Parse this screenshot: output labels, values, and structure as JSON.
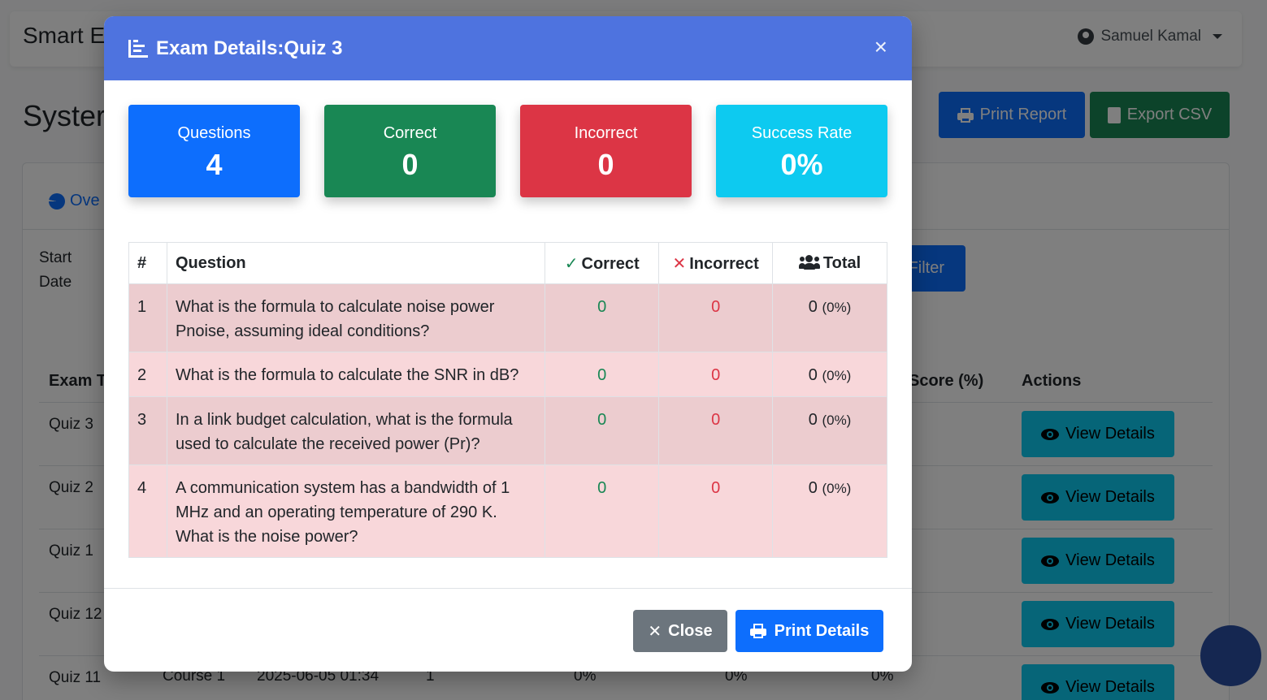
{
  "navbar": {
    "brand": "Smart E",
    "user_name": "Samuel Kamal"
  },
  "page": {
    "title": "Syster",
    "print_report_label": "Print Report",
    "export_csv_label": "Export CSV",
    "tab_overview_label": "Ove",
    "start_date_label": "Start Date",
    "filter_label": "Filter"
  },
  "bg_table": {
    "col_exam": "Exam T",
    "col_score": "Score (%)",
    "col_actions": "Actions",
    "view_details_label": "View Details",
    "rows": [
      {
        "name": "Quiz 3"
      },
      {
        "name": "Quiz 2"
      },
      {
        "name": "Quiz 1"
      },
      {
        "name": "Quiz 12"
      },
      {
        "name": "Quiz 11",
        "course": "Course 1",
        "date": "2025-06-05 01:34",
        "count": "1",
        "p1": "0%",
        "p2": "0%",
        "p3": "0%"
      }
    ]
  },
  "modal": {
    "title": "Exam Details:Quiz 3",
    "close_symbol": "×",
    "stats": [
      {
        "label": "Questions",
        "value": "4",
        "color": "#0d6efd"
      },
      {
        "label": "Correct",
        "value": "0",
        "color": "#198754"
      },
      {
        "label": "Incorrect",
        "value": "0",
        "color": "#dc3545"
      },
      {
        "label": "Success Rate",
        "value": "0%",
        "color": "#0dcaf0"
      }
    ],
    "table": {
      "headers": {
        "num": "#",
        "question": "Question",
        "correct": "Correct",
        "incorrect": "Incorrect",
        "total": "Total"
      },
      "rows": [
        {
          "num": "1",
          "question": "What is the formula to calculate noise power Pnoise, assuming ideal conditions?",
          "correct": "0",
          "incorrect": "0",
          "total": "0",
          "pct": "(0%)"
        },
        {
          "num": "2",
          "question": "What is the formula to calculate the SNR in dB?",
          "correct": "0",
          "incorrect": "0",
          "total": "0",
          "pct": "(0%)"
        },
        {
          "num": "3",
          "question": "In a link budget calculation, what is the formula used to calculate the received power (Pr)?",
          "correct": "0",
          "incorrect": "0",
          "total": "0",
          "pct": "(0%)"
        },
        {
          "num": "4",
          "question": "A communication system has a bandwidth of 1 MHz and an operating temperature of 290 K. What is the noise power?",
          "correct": "0",
          "incorrect": "0",
          "total": "0",
          "pct": "(0%)"
        }
      ]
    },
    "footer": {
      "close_label": "Close",
      "print_label": "Print Details"
    }
  }
}
